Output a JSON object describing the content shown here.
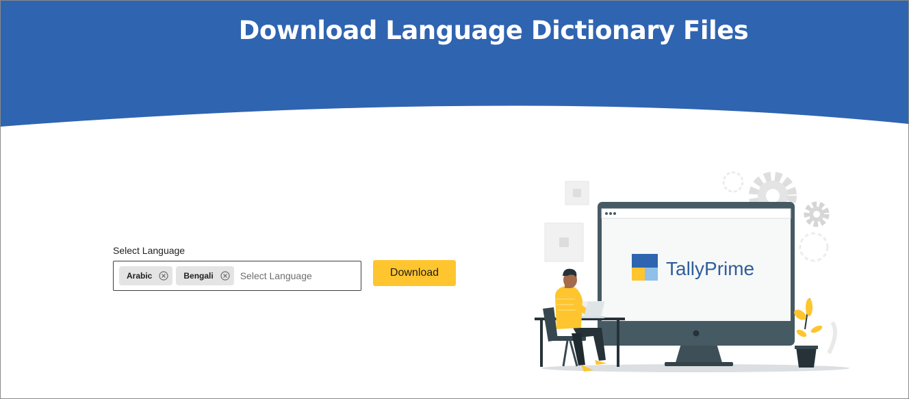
{
  "header": {
    "title": "Download Language Dictionary Files"
  },
  "language_select": {
    "label": "Select Language",
    "selected": [
      "Arabic",
      "Bengali"
    ],
    "placeholder": "Select Language"
  },
  "download_button": {
    "label": "Download"
  },
  "illustration": {
    "brand_name": "TallyPrime"
  },
  "colors": {
    "banner_blue": "#2f64b0",
    "accent_yellow": "#fec52e",
    "monitor_gray": "#465a63"
  }
}
